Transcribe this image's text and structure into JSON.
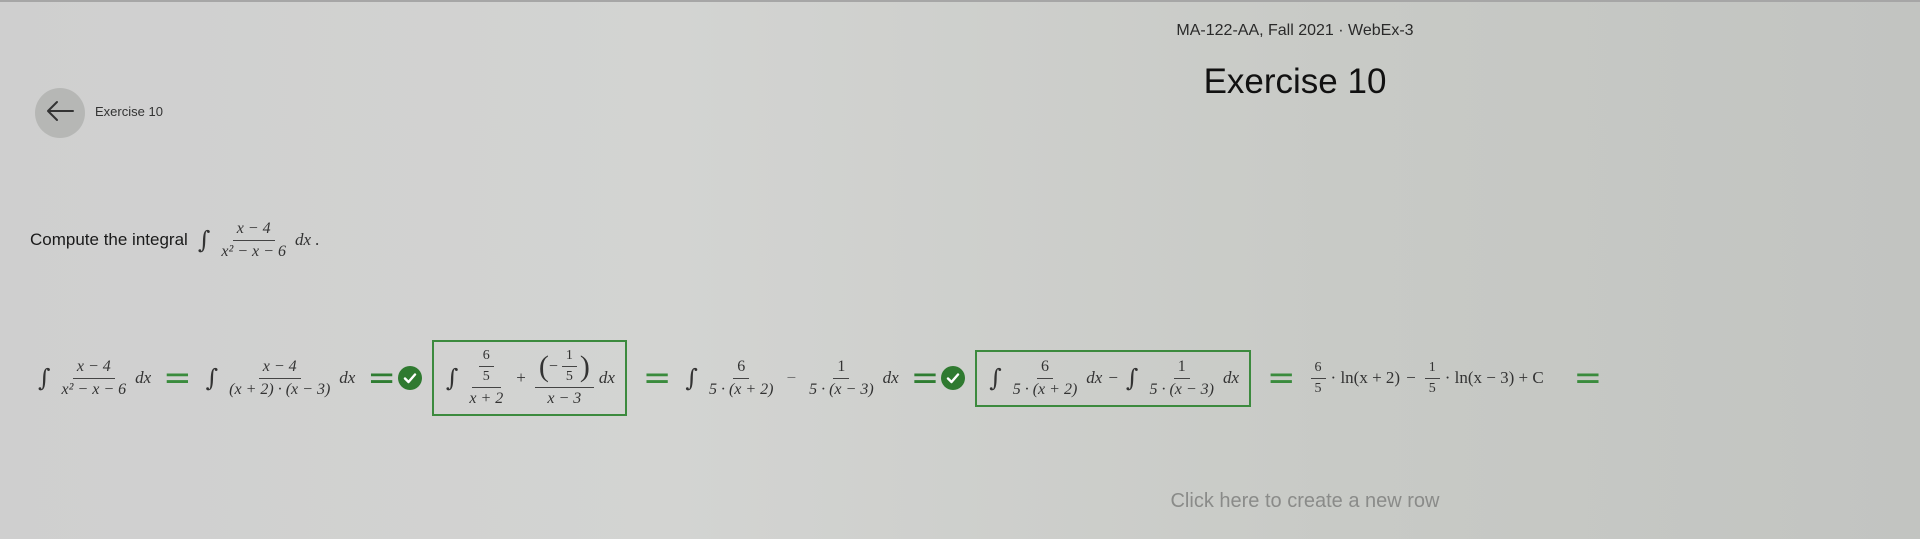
{
  "header": {
    "course": "MA-122-AA, Fall 2021 · WebEx-3",
    "title": "Exercise 10",
    "back_label": "Exercise 10"
  },
  "problem": {
    "prompt": "Compute the integral",
    "numerator": "x − 4",
    "denominator": "x² − x − 6",
    "dx": "dx"
  },
  "steps": {
    "s1": {
      "num": "x − 4",
      "den": "x² − x − 6",
      "dx": "dx"
    },
    "s2": {
      "num": "x − 4",
      "den": "(x + 2) · (x − 3)",
      "dx": "dx"
    },
    "s3": {
      "a_num": "6",
      "a_den": "5",
      "a_outer_den": "x + 2",
      "b_num": "1",
      "b_den": "5",
      "b_outer_den": "x − 3",
      "dx": "dx"
    },
    "s4": {
      "a_num": "6",
      "a_den": "5 · (x + 2)",
      "b_num": "1",
      "b_den": "5 · (x − 3)",
      "dx": "dx"
    },
    "s5": {
      "a_num": "6",
      "a_den": "5 · (x + 2)",
      "b_num": "1",
      "b_den": "5 · (x − 3)",
      "dx": "dx"
    },
    "s6": {
      "a_num": "6",
      "a_den": "5",
      "a_tail": "· ln(x + 2)",
      "b_num": "1",
      "b_den": "5",
      "b_tail": "· ln(x − 3) + C"
    }
  },
  "new_row": "Click here to create a new row",
  "colors": {
    "accent": "#2f7a30",
    "box_border": "#3c8a3e",
    "background": "#cfd0ce"
  },
  "icons": {
    "back": "arrow-left-icon",
    "check": "check-circle-icon"
  }
}
